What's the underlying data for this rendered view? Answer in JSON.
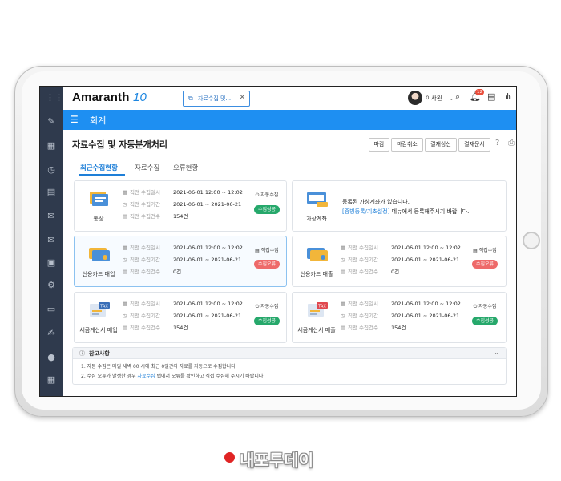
{
  "app": {
    "logo_main": "Amaranth",
    "logo_num": "10",
    "open_tab": "자료수집 및...",
    "user_name": "이사원",
    "notification_count": "12"
  },
  "menu": {
    "title": "회계"
  },
  "page": {
    "title": "자료수집 및 자동분개처리",
    "buttons": {
      "close": "마감",
      "cancel_close": "마감취소",
      "approval_submit": "결재상신",
      "approval_doc": "결재문서"
    }
  },
  "tabs": {
    "recent": "최근수집현황",
    "collect": "자료수집",
    "errors": "오류현황"
  },
  "labels": {
    "last_time": "직전 수집일시",
    "last_period": "직전 수집기간",
    "last_count": "직전 수집건수"
  },
  "cards": {
    "bank": {
      "name": "통장",
      "time": "2021-06-01   12:00 ~ 12:02",
      "period": "2021-06-01 ~ 2021-06-21",
      "count": "154건",
      "mode": "자동수집",
      "status": "수집성공"
    },
    "virtual": {
      "name": "가상계좌",
      "msg1": "등록된 가상계좌가 없습니다.",
      "msg_link": "[증빙등록/기초설정]",
      "msg2": " 메뉴에서 등록해주시기 바랍니다."
    },
    "card_buy": {
      "name": "신용카드 매입",
      "time": "2021-06-01   12:00 ~ 12:02",
      "period": "2021-06-01 ~ 2021-06-21",
      "count": "0건",
      "mode": "직접수집",
      "status": "수집오류"
    },
    "card_sell": {
      "name": "신용카드 매출",
      "time": "2021-06-01   12:00 ~ 12:02",
      "period": "2021-06-01 ~ 2021-06-21",
      "count": "0건",
      "mode": "직접수집",
      "status": "수집오류"
    },
    "tax_buy": {
      "name": "세금계산서 매입",
      "time": "2021-06-01   12:00 ~ 12:02",
      "period": "2021-06-01 ~ 2021-06-21",
      "count": "154건",
      "mode": "자동수집",
      "status": "수집성공"
    },
    "tax_sell": {
      "name": "세금계산서 매출",
      "time": "2021-06-01   12:00 ~ 12:02",
      "period": "2021-06-01 ~ 2021-06-21",
      "count": "154건",
      "mode": "자동수집",
      "status": "수집성공"
    }
  },
  "notice": {
    "title": "참고사항",
    "line1": "1. 자동 수집은 매일 새벽 00 시에 최근 0일간의 자료를 자동으로 수집합니다.",
    "line2a": "2. 수집 오류가 발생한 경우 ",
    "line2_link": "자료수집",
    "line2b": " 탭에서 오류를 확인하고 직접 수집해 주시기 바랍니다."
  },
  "watermark": {
    "text": "내포투데이"
  },
  "colors": {
    "primary": "#1e8ff2",
    "sidebar": "#2f3a4d",
    "success": "#26a86b",
    "error": "#ee6a6a"
  }
}
